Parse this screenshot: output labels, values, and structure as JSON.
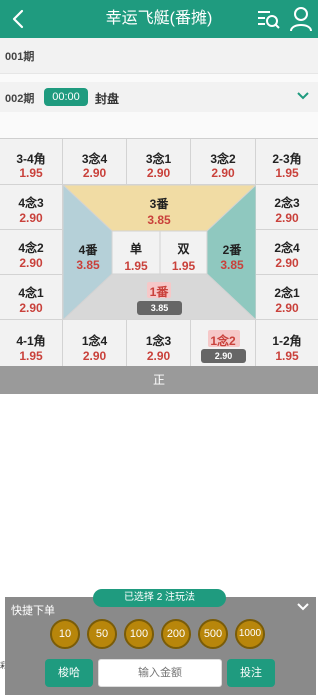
{
  "header": {
    "title": "幸运飞艇(番摊)"
  },
  "issues": {
    "prev_issue": "001期",
    "current_issue": "002期",
    "countdown": "00:00",
    "status": "封盘"
  },
  "board": {
    "top_row": [
      {
        "name": "3-4角",
        "odds": "1.95"
      },
      {
        "name": "3念4",
        "odds": "2.90"
      },
      {
        "name": "3念1",
        "odds": "2.90"
      },
      {
        "name": "3念2",
        "odds": "2.90"
      },
      {
        "name": "2-3角",
        "odds": "1.95"
      }
    ],
    "left_col": [
      {
        "name": "4念3",
        "odds": "2.90"
      },
      {
        "name": "4念2",
        "odds": "2.90"
      },
      {
        "name": "4念1",
        "odds": "2.90"
      }
    ],
    "right_col": [
      {
        "name": "2念3",
        "odds": "2.90"
      },
      {
        "name": "2念4",
        "odds": "2.90"
      },
      {
        "name": "2念1",
        "odds": "2.90"
      }
    ],
    "bottom_row": [
      {
        "name": "4-1角",
        "odds": "1.95"
      },
      {
        "name": "1念4",
        "odds": "2.90"
      },
      {
        "name": "1念3",
        "odds": "2.90"
      },
      {
        "name": "1念2",
        "odds": "2.90"
      },
      {
        "name": "1-2角",
        "odds": "1.95"
      }
    ],
    "center": {
      "fan3": {
        "name": "3番",
        "odds": "3.85"
      },
      "fan4": {
        "name": "4番",
        "odds": "3.85"
      },
      "fan2": {
        "name": "2番",
        "odds": "3.85"
      },
      "fan1": {
        "name": "1番",
        "odds": "3.85"
      },
      "odd": {
        "name": "单",
        "odds": "1.95"
      },
      "even": {
        "name": "双",
        "odds": "1.95"
      }
    },
    "colors": {
      "fan3": "#f1dca4",
      "fan4": "#b5d0d8",
      "fan2": "#8fc8bf",
      "fan1": "#d8d8d8"
    }
  },
  "zheng_label": "正",
  "quick_bet": {
    "selected_text": "已选择 2 注玩法",
    "title": "快捷下单",
    "chips": [
      "10",
      "50",
      "100",
      "200",
      "500",
      "1000"
    ],
    "reset_label": "梭哈",
    "amount_placeholder": "输入金额",
    "submit_label": "投注"
  },
  "stray_char": "彩"
}
